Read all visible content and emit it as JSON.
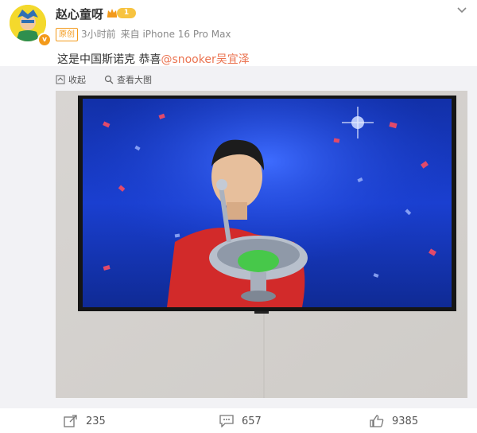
{
  "post": {
    "author": "赵心童呀",
    "level": "1",
    "original_badge": "原创",
    "time": "3小时前",
    "source": "来自 iPhone 16 Pro Max",
    "text_prefix": "这是中国斯诺克 恭喜",
    "mention": "@snooker",
    "text_suffix": "吴宜泽"
  },
  "media_toolbar": {
    "collapse_label": "收起",
    "view_large_label": "查看大图"
  },
  "actions": {
    "repost_count": "235",
    "comment_count": "657",
    "like_count": "9385"
  },
  "colors": {
    "accent_orange": "#f39a1b",
    "mention": "#eb7350",
    "badge_yellow": "#f7c340"
  },
  "icons": [
    "crown-icon",
    "chevron-down-icon",
    "collapse-icon",
    "zoom-icon",
    "repost-icon",
    "comment-icon",
    "like-icon"
  ]
}
